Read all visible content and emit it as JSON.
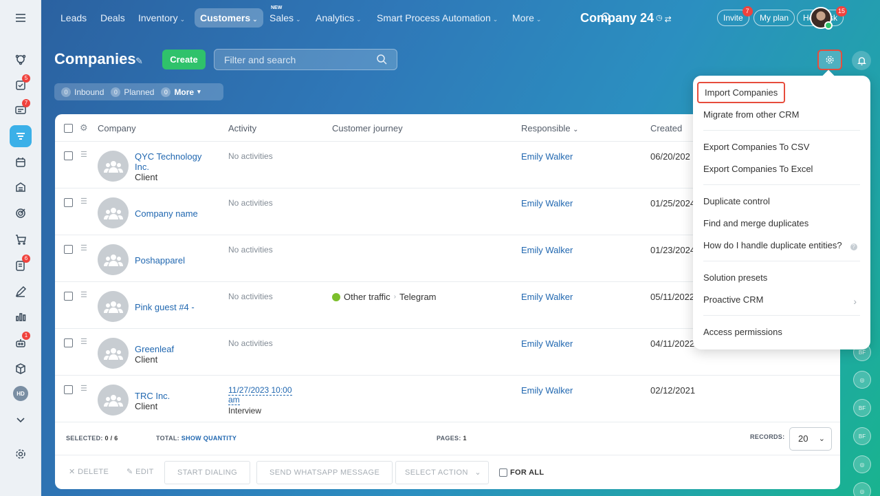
{
  "nav": {
    "items": [
      "Leads",
      "Deals",
      "Inventory",
      "Customers",
      "Sales",
      "Analytics",
      "Smart Process Automation",
      "More"
    ],
    "new_label": "NEW",
    "brand": "Company 24",
    "invite": "Invite",
    "invite_badge": "7",
    "myplan": "My plan",
    "helpdesk": "Helpdesk",
    "helpdesk_badge": "15"
  },
  "sidebar": {
    "badges": {
      "tasks": "5",
      "chat": "7",
      "forms": "6",
      "robots": "1"
    },
    "hd_label": "HD"
  },
  "header": {
    "title": "Companies",
    "create_label": "Create",
    "search_placeholder": "Filter and search"
  },
  "counters": [
    {
      "count": "0",
      "label": "Inbound"
    },
    {
      "count": "0",
      "label": "Planned"
    },
    {
      "count": "0",
      "label": "More"
    }
  ],
  "table": {
    "columns": [
      "Company",
      "Activity",
      "Customer journey",
      "Responsible",
      "Created"
    ],
    "rows": [
      {
        "name": "QYC Technology Inc.",
        "type": "Client",
        "activity": "No activities",
        "journey": "",
        "journey_to": "",
        "responsible": "Emily Walker",
        "created": "06/20/202"
      },
      {
        "name": "Company name",
        "type": "",
        "activity": "No activities",
        "journey": "",
        "journey_to": "",
        "responsible": "Emily Walker",
        "created": "01/25/2024"
      },
      {
        "name": "Poshapparel",
        "type": "",
        "activity": "No activities",
        "journey": "",
        "journey_to": "",
        "responsible": "Emily Walker",
        "created": "01/23/2024"
      },
      {
        "name": "Pink guest #4 -",
        "type": "",
        "activity": "No activities",
        "journey": "Other traffic",
        "journey_to": "Telegram",
        "responsible": "Emily Walker",
        "created": "05/11/2022"
      },
      {
        "name": "Greenleaf",
        "type": "Client",
        "activity": "No activities",
        "journey": "",
        "journey_to": "",
        "responsible": "Emily Walker",
        "created": "04/11/2022"
      },
      {
        "name": "TRC Inc.",
        "type": "Client",
        "activity": "11/27/2023 10:00 am",
        "activity_sub": "Interview",
        "journey": "",
        "journey_to": "",
        "responsible": "Emily Walker",
        "created": "02/12/2021"
      }
    ]
  },
  "footer": {
    "selected_label": "SELECTED:",
    "selected_value": "0 / 6",
    "total_label": "TOTAL:",
    "total_link": "SHOW QUANTITY",
    "pages_label": "PAGES:",
    "pages_value": "1",
    "records_label": "RECORDS:",
    "records_value": "20",
    "delete": "DELETE",
    "edit": "EDIT",
    "start_dialing": "START DIALING",
    "whatsapp": "SEND WHATSAPP MESSAGE",
    "select_action": "SELECT ACTION",
    "for_all": "FOR ALL"
  },
  "strip": [
    "BF",
    "BF",
    "BF"
  ],
  "menu": {
    "import": "Import Companies",
    "migrate": "Migrate from other CRM",
    "export_csv": "Export Companies To CSV",
    "export_excel": "Export Companies To Excel",
    "duplicate_control": "Duplicate control",
    "find_merge": "Find and merge duplicates",
    "handle_dup": "How do I handle duplicate entities?",
    "solution_presets": "Solution presets",
    "proactive": "Proactive CRM",
    "access": "Access permissions"
  },
  "colors": {
    "accent": "#2fc26b",
    "link": "#2067b0",
    "highlight": "#e64c3c",
    "badge": "#f0423d"
  }
}
